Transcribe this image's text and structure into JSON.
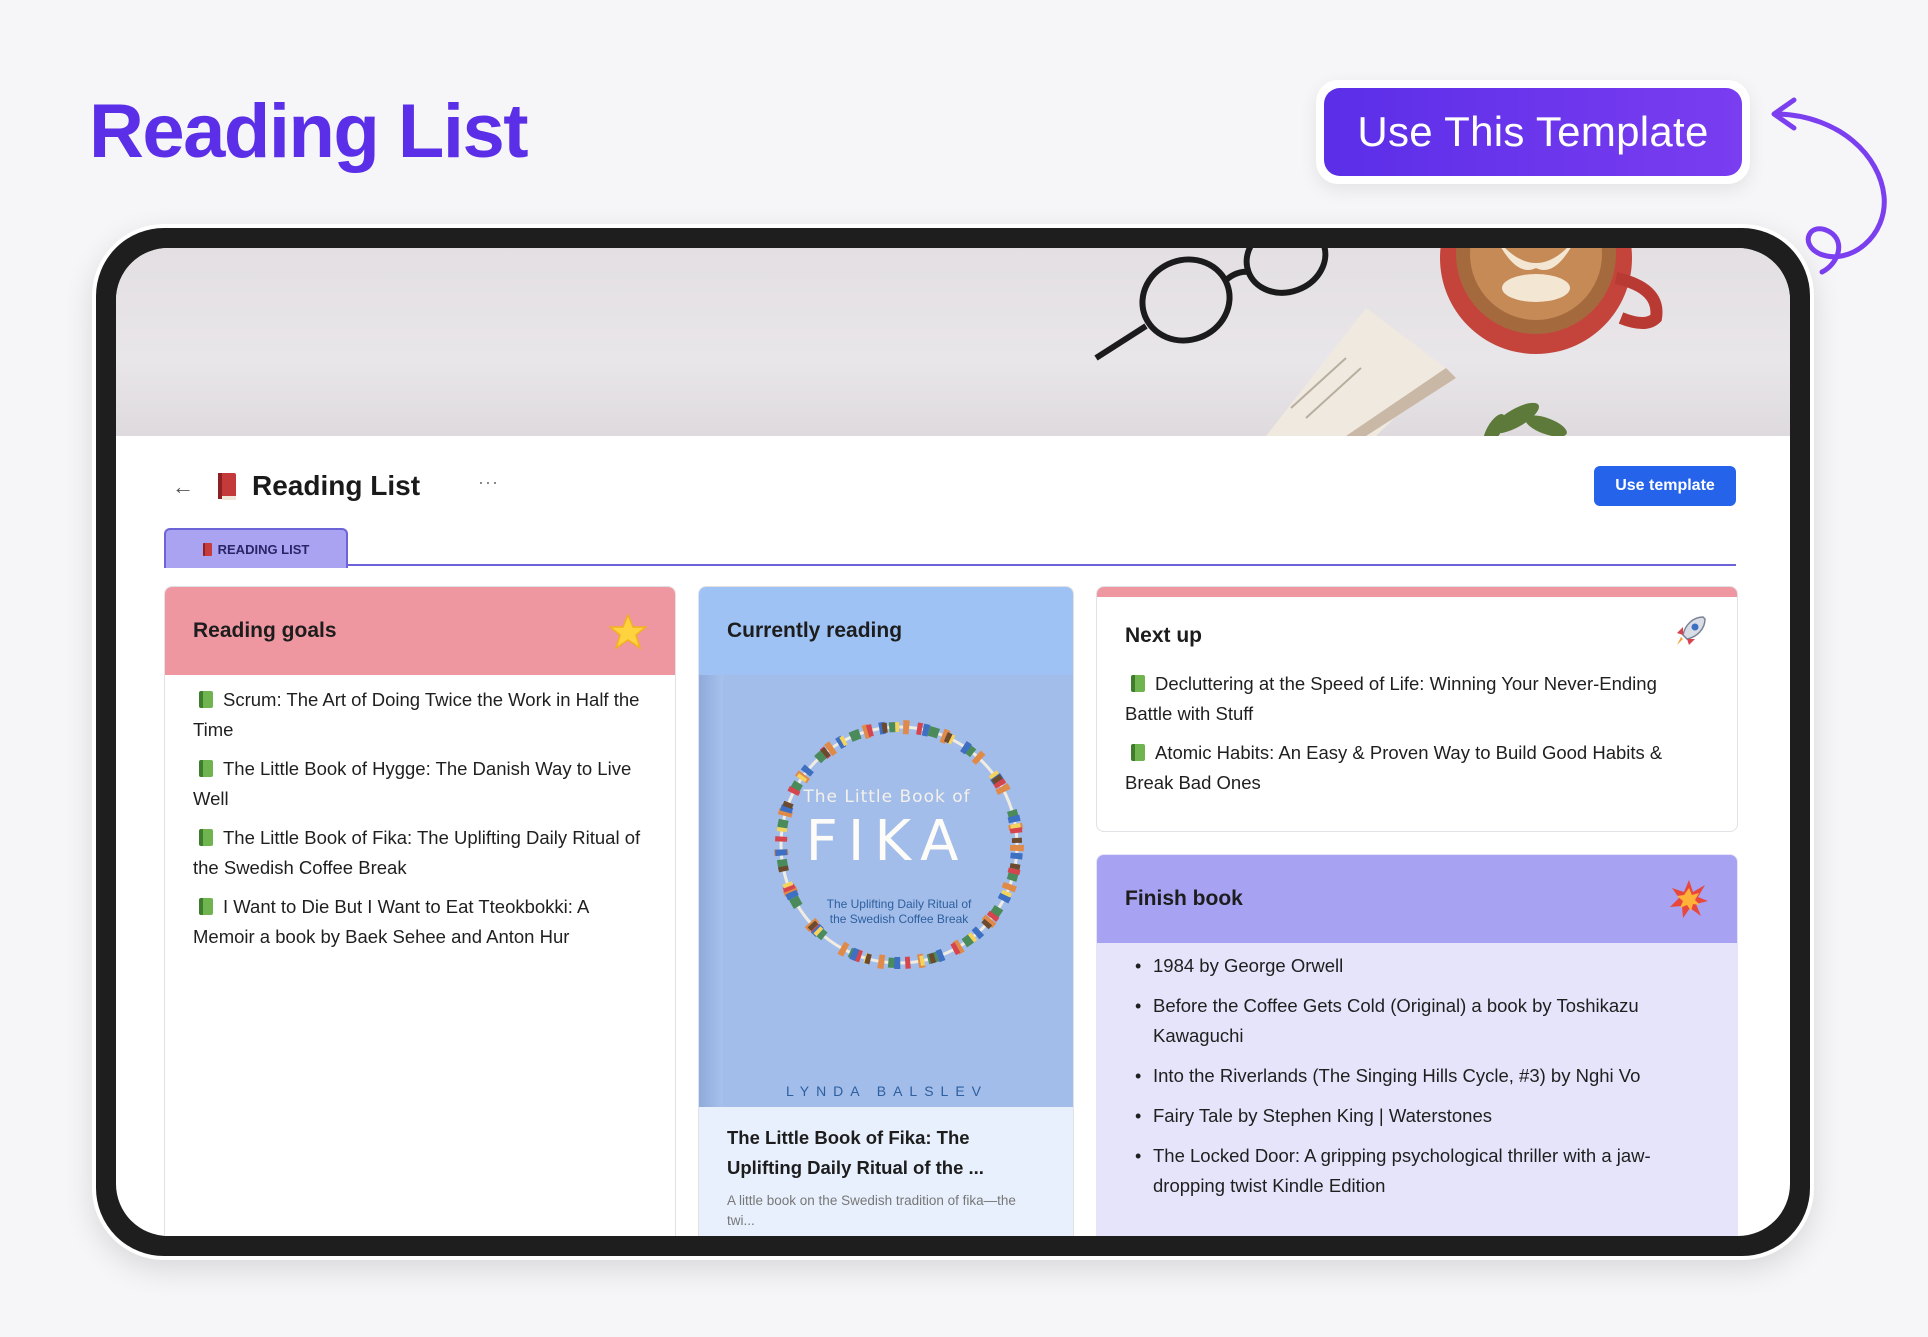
{
  "promo": {
    "title": "Reading List",
    "cta": "Use This Template"
  },
  "page": {
    "back_icon": "←",
    "title": "Reading List",
    "more_icon": "···",
    "use_template": "Use template",
    "tab_label": "READING LIST"
  },
  "goals": {
    "title": "Reading goals",
    "icon": "star-icon",
    "items": [
      "Scrum: The Art of Doing Twice the Work in Half the Time",
      "The Little Book of Hygge: The Danish Way to Live Well",
      "The Little Book of Fika: The Uplifting Daily Ritual of the Swedish Coffee Break",
      "I Want to Die But I Want to Eat Tteokbokki: A Memoir a book by Baek Sehee and Anton Hur"
    ]
  },
  "reading": {
    "title": "Currently reading",
    "cover": {
      "small": "The Little Book of",
      "big": "FIKA",
      "sub": "The Uplifting Daily Ritual of the Swedish Coffee Break",
      "author": "LYNDA BALSLEV"
    },
    "book_title": "The Little Book of Fika: The Uplifting Daily Ritual of the ...",
    "book_desc": "A little book on the Swedish tradition of fika—the twi..."
  },
  "nextup": {
    "title": "Next up",
    "icon": "rocket-icon",
    "items": [
      "Decluttering at the Speed of Life: Winning Your Never-Ending Battle with Stuff",
      "Atomic Habits: An Easy & Proven Way to Build Good Habits & Break Bad Ones"
    ]
  },
  "finish": {
    "title": "Finish book",
    "icon": "explosion-icon",
    "items": [
      "1984 by George Orwell",
      "Before the Coffee Gets Cold (Original) a book by Toshikazu Kawaguchi",
      "Into the Riverlands (The Singing Hills Cycle, #3) by Nghi Vo",
      "Fairy Tale by Stephen King | Waterstones",
      "The Locked Door: A gripping psychological thriller with a jaw-dropping twist Kindle Edition"
    ]
  },
  "colors": {
    "brand_purple": "#5b2ee8",
    "goals_header": "#ef97a1",
    "reading_header": "#9fc2f5",
    "finish_header": "#a7a2f2",
    "button_blue": "#2563eb"
  }
}
